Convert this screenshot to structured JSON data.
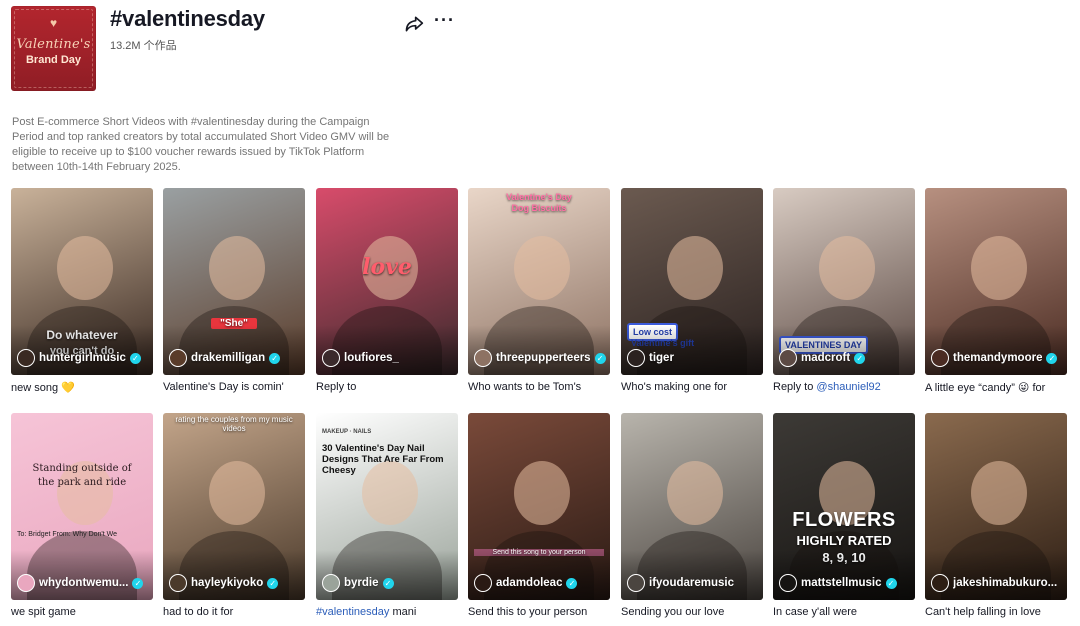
{
  "header": {
    "title": "#valentinesday",
    "count": "13.2M 个作品",
    "cover": {
      "line1": "Valentine's",
      "line2": "Brand Day"
    },
    "share_icon": "share-arrow-icon",
    "more_icon": "more-dots-icon"
  },
  "description": "Post E-commerce Short Videos with #valentinesday during the Campaign Period and top ranked creators by total accumulated Short Video GMV will be eligible to receive up to $100 voucher rewards issued by TikTok Platform between 10th-14th February 2025.",
  "videos": [
    {
      "creator": "huntergirlmusic",
      "verified": true,
      "caption": "new song 💛",
      "overlay": "Do whatever",
      "overlay2": "you can't do",
      "colors": [
        "#c9b29a",
        "#3a2a22"
      ]
    },
    {
      "creator": "drakemilligan",
      "verified": true,
      "caption": "Valentine's Day is comin'",
      "overlay": "\"She\"",
      "colors": [
        "#9aa0a2",
        "#5a3c2a"
      ]
    },
    {
      "creator": "loufiores_",
      "verified": false,
      "caption": "Reply to",
      "overlay": "love",
      "colors": [
        "#d84c6b",
        "#3b2a2c"
      ]
    },
    {
      "creator": "threepupperteers",
      "verified": true,
      "caption": "Who wants to be Tom's",
      "overlay": "Valentine's Day",
      "overlay2": "Dog Biscuits",
      "colors": [
        "#e9d6c8",
        "#8d7263"
      ]
    },
    {
      "creator": "tiger",
      "verified": false,
      "caption": "Who's making one for",
      "overlay": "Low cost",
      "overlay2": "Valentine's gift",
      "colors": [
        "#6b5a50",
        "#2b2220"
      ]
    },
    {
      "creator": "madcroft",
      "verified": true,
      "caption": "Reply to",
      "caption_mention": "@shauniel92",
      "overlay": "VALENTINES DAY",
      "colors": [
        "#d8cbc2",
        "#5c4a44"
      ]
    },
    {
      "creator": "themandymoore",
      "verified": true,
      "caption": "A little eye “candy” 😜 for",
      "colors": [
        "#b79080",
        "#4a2b22"
      ]
    },
    {
      "creator": "whydontwemu...",
      "verified": true,
      "caption": "we spit game",
      "overlay": "Standing outside of",
      "overlay2": "the park and ride",
      "overlay3": "To: Bridget From: Why Don't We",
      "colors": [
        "#f6c4d7",
        "#e9a7bf"
      ]
    },
    {
      "creator": "hayleykiyoko",
      "verified": true,
      "caption": "had to do it for",
      "overlay": "rating the couples from my music videos",
      "colors": [
        "#c3a58a",
        "#4b3a2b"
      ]
    },
    {
      "creator": "byrdie",
      "verified": true,
      "caption": "mani",
      "caption_tag": "#valentinesday",
      "overlay": "30 Valentine's Day Nail Designs That Are Far From Cheesy",
      "overlay_small": "MAKEUP · NAILS",
      "colors": [
        "#ffffff",
        "#9aa39a"
      ]
    },
    {
      "creator": "adamdoleac",
      "verified": true,
      "caption": "Send this to your person",
      "overlay": "Send this song to your person",
      "colors": [
        "#7a4a3a",
        "#2a1a14"
      ]
    },
    {
      "creator": "ifyoudaremusic",
      "verified": false,
      "caption": "Sending you our love",
      "colors": [
        "#b8b4ac",
        "#4b4540"
      ]
    },
    {
      "creator": "mattstellmusic",
      "verified": true,
      "caption": "In case y'all were",
      "overlay": "FLOWERS",
      "overlay2": "HIGHLY RATED",
      "overlay3": "8, 9, 10",
      "colors": [
        "#3d3a36",
        "#161412"
      ]
    },
    {
      "creator": "jakeshimabukuro...",
      "verified": false,
      "caption": "Can't help falling in love",
      "colors": [
        "#8a6a4e",
        "#2d1e14"
      ]
    }
  ]
}
